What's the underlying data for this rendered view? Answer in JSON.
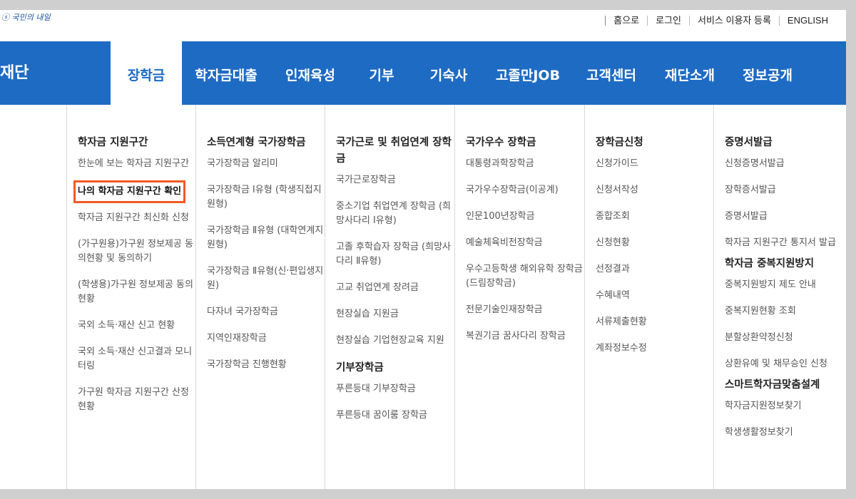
{
  "logo": {
    "text": "ⓢ 국민의 내일"
  },
  "topbar": [
    "홈으로",
    "로그인",
    "서비스 이용자 등록",
    "ENGLISH"
  ],
  "brand": "재단",
  "menu": [
    {
      "label": "장학금",
      "active": true
    },
    {
      "label": "학자금대출"
    },
    {
      "label": "인재육성"
    },
    {
      "label": "기부"
    },
    {
      "label": "기숙사"
    },
    {
      "label": "고졸만JOB"
    },
    {
      "label": "고객센터"
    },
    {
      "label": "재단소개"
    },
    {
      "label": "정보공개"
    }
  ],
  "columns": [
    {
      "groups": [
        {
          "heading": "학자금 지원구간",
          "items": [
            "한눈에 보는 학자금 지원구간",
            "나의 학자금 지원구간 확인",
            "학자금 지원구간 최신화 신청",
            "(가구원용)가구원 정보제공 동의현황 및 동의하기",
            "(학생용)가구원 정보제공 동의현황",
            "국외 소득·재산 신고 현황",
            "국외 소득·재산 신고결과 모니터링",
            "가구원 학자금 지원구간 산정 현황"
          ]
        }
      ]
    },
    {
      "groups": [
        {
          "heading": "소득연계형 국가장학금",
          "items": [
            "국가장학금 알리미",
            "국가장학금 Ⅰ유형 (학생직접지원형)",
            "국가장학금 Ⅱ유형 (대학연계지원형)",
            "국가장학금 Ⅱ유형(신·편입생지원)",
            "다자녀 국가장학금",
            "지역인재장학금",
            "국가장학금 진행현황"
          ]
        }
      ]
    },
    {
      "groups": [
        {
          "heading": "국가근로 및 취업연계 장학금",
          "items": [
            "국가근로장학금",
            "중소기업 취업연계 장학금 (희망사다리 Ⅰ유형)",
            "고졸 후학습자 장학금 (희망사다리 Ⅱ유형)",
            "고교 취업연계 장려금",
            "현장실습 지원금",
            "현장실습 기업현장교육 지원"
          ]
        },
        {
          "heading": "기부장학금",
          "items": [
            "푸른등대 기부장학금",
            "푸른등대 꿈이룸 장학금"
          ]
        }
      ]
    },
    {
      "groups": [
        {
          "heading": "국가우수 장학금",
          "items": [
            "대통령과학장학금",
            "국가우수장학금(이공계)",
            "인문100년장학금",
            "예술체육비전장학금",
            "우수고등학생 해외유학 장학금(드림장학금)",
            "전문기술인재장학금",
            "복권기금 꿈사다리 장학금"
          ]
        }
      ]
    },
    {
      "groups": [
        {
          "heading": "장학금신청",
          "items": [
            "신청가이드",
            "신청서작성",
            "종합조회",
            "신청현황",
            "선정결과",
            "수혜내역",
            "서류제출현황",
            "계좌정보수정"
          ]
        }
      ]
    },
    {
      "groups": [
        {
          "heading": "증명서발급",
          "items": [
            "신청증명서발급",
            "장학증서발급",
            "증명서발급",
            "학자금 지원구간 통지서 발급"
          ]
        },
        {
          "heading": "학자금 중복지원방지",
          "items": [
            "중복지원방지 제도 안내",
            "중복지원현황 조회",
            "분할상환약정신청",
            "상환유예 및 채무승인 신청"
          ]
        },
        {
          "heading": "스마트학자금맞춤설계",
          "items": [
            "학자금지원정보찾기",
            "학생생활정보찾기"
          ]
        }
      ]
    }
  ],
  "highlight": {
    "label": "나의 학자금 지원구간 확인",
    "color": "#f05a24"
  },
  "colors": {
    "nav": "#1e6bc4",
    "highlight": "#f05a24"
  }
}
